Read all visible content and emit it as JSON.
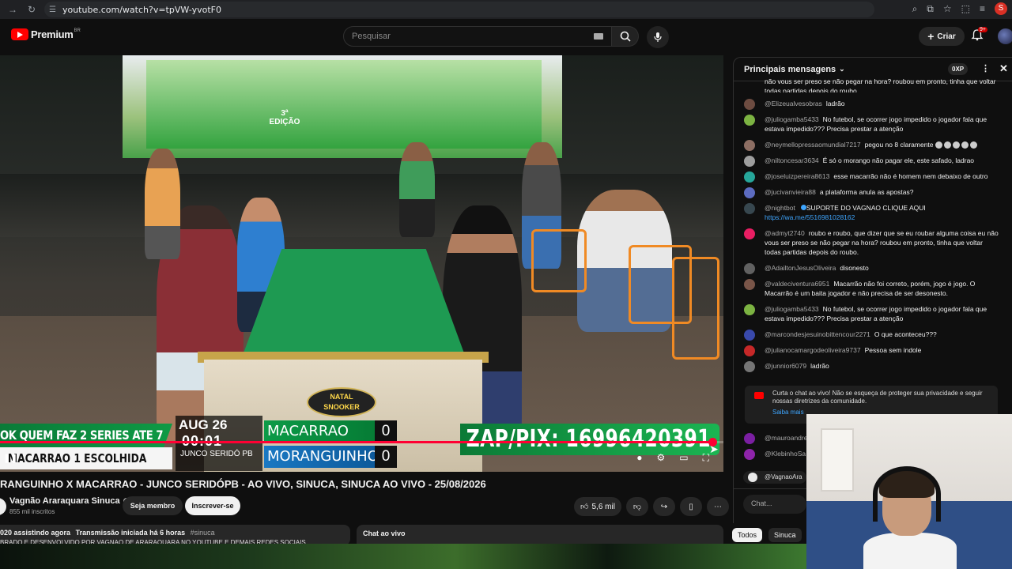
{
  "browser": {
    "url": "youtube.com/watch?v=tpVW-yvotF0",
    "profile_initial": "S"
  },
  "header": {
    "logo_text": "Premium",
    "region": "BR",
    "search_placeholder": "Pesquisar",
    "create_label": "Criar",
    "notif_badge": "9+"
  },
  "video": {
    "overlay_top_left": "OK QUEM FAZ 2 SERIES ATE 7",
    "overlay_bottom_left": "MACARRAO 1 ESCOLHIDA",
    "date": "AUG 26",
    "time": "00:01",
    "location": "JUNCO SERIDÓ PB",
    "player1": "MACARRAO",
    "score1": "0",
    "player2": "MORANGUINHO",
    "score2": "0",
    "pix": "ZAP/PIX: 16996420391",
    "banner_edition": "3ª EDIÇÃO",
    "table_logo_line1": "NATAL",
    "table_logo_line2": "SNOOKER",
    "progress": 0.985
  },
  "meta": {
    "title": "RANGUINHO X MACARRAO - JUNCO SERIDÓPB - AO VIVO, SINUCA, SINUCA AO VIVO - 25/08/2026",
    "channel": "Vagnão Araraquara Sinuca",
    "subscribers": "855 mil inscritos",
    "member_label": "Seja membro",
    "subscribe_label": "Inscrever-se",
    "likes": "5,6 mil",
    "watching": "020 assistindo agora",
    "started": "Transmissão iniciada há 6 horas",
    "hashtag": "#sinuca",
    "desc_line2": "BRADO E DESENVOLVIDO POR VAGNAO DE ARARAQUARA NO YOUTUBE E DEMAIS REDES SOCIAIS",
    "chat_live_label": "Chat ao vivo"
  },
  "chat": {
    "header": "Principais mensagens",
    "xp": "0XP",
    "partial_top": "não vous ser preso se não pegar na hora? roubou em pronto, tinha que voltar todas partidas depois do roubo.",
    "messages": [
      {
        "author": "@Elizeualvesobras",
        "text": "ladrão",
        "color": "#6d4c41"
      },
      {
        "author": "@juliogamba5433",
        "text": "No futebol, se ocorrer jogo impedido o jogador fala que estava impedido??? Precisa prestar a atenção",
        "color": "#7cb342"
      },
      {
        "author": "@neymellopressaomundial7217",
        "text": "pegou no 8 claramente",
        "color": "#8d6e63"
      },
      {
        "author": "@niltoncesar3634",
        "text": "É só o morango não pagar ele, este safado, ladrao",
        "color": "#9e9e9e"
      },
      {
        "author": "@joseluizpereira8613",
        "text": "esse macarrão não é homem nem debaixo de outro",
        "color": "#26a69a"
      },
      {
        "author": "@jucivanvieira88",
        "text": "a plataforma anula as apostas?",
        "color": "#5c6bc0"
      },
      {
        "author": "@nightbot",
        "text": "SUPORTE DO VAGNAO CLIQUE AQUI",
        "link": "https://wa.me/5516981028162",
        "color": "#37474f"
      },
      {
        "author": "@admyt2740",
        "text": "roubo e roubo, que dizer que se eu roubar alguma coisa eu não vous ser preso se não pegar na hora? roubou em pronto, tinha que voltar todas partidas depois do roubo.",
        "color": "#e91e63"
      },
      {
        "author": "@AdailtonJesusOliveira",
        "text": "disonesto",
        "color": "#616161"
      },
      {
        "author": "@valdeciventura6951",
        "text": "Macarrão não foi correto, porém, jogo é jogo. O Macarrão é um baita jogador e não precisa de ser desonesto.",
        "color": "#795548"
      },
      {
        "author": "@juliogamba5433",
        "text": "No futebol, se ocorrer jogo impedido o jogador fala que estava impedido??? Precisa prestar a atenção",
        "color": "#7cb342"
      },
      {
        "author": "@marcondesjesuinobittencour2271",
        "text": "O que aconteceu???",
        "color": "#3949ab"
      },
      {
        "author": "@julianocamargodeoliveira9737",
        "text": "Pessoa sem indole",
        "color": "#c62828"
      },
      {
        "author": "@junnior6079",
        "text": "ladrão",
        "color": "#757575"
      }
    ],
    "notice": "Curta o chat ao vivo! Não se esqueça de proteger sua privacidade e seguir nossas diretrizes da comunidade.",
    "notice_link": "Saiba mais",
    "bottom_messages": [
      {
        "author": "@mauroandre",
        "color": "#7b1fa2"
      },
      {
        "author": "@KlebinhoSa",
        "color": "#8e24aa"
      }
    ],
    "reply_author": "@VagnaoAra",
    "input_placeholder": "Chat...",
    "chips": [
      "Todos",
      "Sinuca"
    ]
  }
}
